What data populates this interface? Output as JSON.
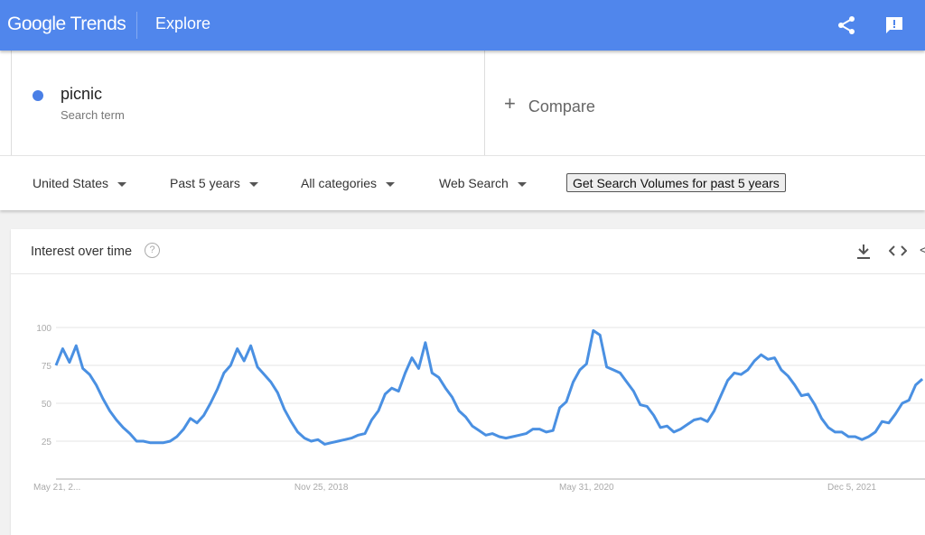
{
  "header": {
    "logo": "Google Trends",
    "section": "Explore",
    "icons": [
      "share-icon",
      "feedback-icon"
    ],
    "color": "#5086ec"
  },
  "search": {
    "term": "picnic",
    "term_type": "Search term",
    "term_color": "#4a7fe6",
    "compare_label": "Compare"
  },
  "filters": {
    "region": "United States",
    "time": "Past 5 years",
    "category": "All categories",
    "type": "Web Search",
    "volumes_button": "Get Search Volumes for past 5 years"
  },
  "card": {
    "title": "Interest over time",
    "icons": [
      "help-icon",
      "download-icon",
      "embed-icon",
      "share-icon"
    ]
  },
  "chart_data": {
    "type": "line",
    "title": "Interest over time",
    "series_color": "#4a90e2",
    "yticks": [
      "100",
      "75",
      "50",
      "25"
    ],
    "ylim": [
      0,
      100
    ],
    "xticks": [
      {
        "date": "2017-05-21",
        "label": "May 21, 2..."
      },
      {
        "date": "2018-11-25",
        "label": "Nov 25, 2018"
      },
      {
        "date": "2020-05-31",
        "label": "May 31, 2020"
      },
      {
        "date": "2021-12-05",
        "label": "Dec 5, 2021"
      }
    ],
    "grid": true,
    "x": [
      "2017-05-21",
      "2017-06-04",
      "2017-06-18",
      "2017-07-02",
      "2017-07-16",
      "2017-07-30",
      "2017-08-13",
      "2017-08-27",
      "2017-09-10",
      "2017-09-24",
      "2017-10-08",
      "2017-10-22",
      "2017-11-05",
      "2017-11-19",
      "2017-12-03",
      "2017-12-17",
      "2017-12-31",
      "2018-01-14",
      "2018-01-28",
      "2018-02-11",
      "2018-02-25",
      "2018-03-11",
      "2018-03-25",
      "2018-04-08",
      "2018-04-22",
      "2018-05-06",
      "2018-05-20",
      "2018-06-03",
      "2018-06-17",
      "2018-07-01",
      "2018-07-15",
      "2018-07-29",
      "2018-08-12",
      "2018-08-26",
      "2018-09-09",
      "2018-09-23",
      "2018-10-07",
      "2018-10-21",
      "2018-11-04",
      "2018-11-18",
      "2018-12-02",
      "2018-12-16",
      "2018-12-30",
      "2019-01-13",
      "2019-01-27",
      "2019-02-10",
      "2019-02-24",
      "2019-03-10",
      "2019-03-24",
      "2019-04-07",
      "2019-04-21",
      "2019-05-05",
      "2019-05-19",
      "2019-06-02",
      "2019-06-16",
      "2019-06-30",
      "2019-07-14",
      "2019-07-28",
      "2019-08-11",
      "2019-08-25",
      "2019-09-08",
      "2019-09-22",
      "2019-10-06",
      "2019-10-20",
      "2019-11-03",
      "2019-11-17",
      "2019-12-01",
      "2019-12-15",
      "2019-12-29",
      "2020-01-12",
      "2020-01-26",
      "2020-02-09",
      "2020-02-23",
      "2020-03-08",
      "2020-03-22",
      "2020-04-05",
      "2020-04-19",
      "2020-05-03",
      "2020-05-17",
      "2020-05-31",
      "2020-06-14",
      "2020-06-28",
      "2020-07-12",
      "2020-07-26",
      "2020-08-09",
      "2020-08-23",
      "2020-09-06",
      "2020-09-20",
      "2020-10-04",
      "2020-10-18",
      "2020-11-01",
      "2020-11-15",
      "2020-11-29",
      "2020-12-13",
      "2020-12-27",
      "2021-01-10",
      "2021-01-24",
      "2021-02-07",
      "2021-02-21",
      "2021-03-07",
      "2021-03-21",
      "2021-04-04",
      "2021-04-18",
      "2021-05-02",
      "2021-05-16",
      "2021-05-30",
      "2021-06-13",
      "2021-06-27",
      "2021-07-11",
      "2021-07-25",
      "2021-08-08",
      "2021-08-22",
      "2021-09-05",
      "2021-09-19",
      "2021-10-03",
      "2021-10-17",
      "2021-10-31",
      "2021-11-14",
      "2021-11-28",
      "2021-12-12",
      "2021-12-26",
      "2022-01-09",
      "2022-01-23",
      "2022-02-06",
      "2022-02-20",
      "2022-03-06",
      "2022-03-20",
      "2022-04-03",
      "2022-04-17",
      "2022-05-01"
    ],
    "values": [
      75,
      86,
      77,
      88,
      73,
      69,
      62,
      53,
      45,
      39,
      34,
      30,
      25,
      25,
      24,
      24,
      24,
      25,
      28,
      33,
      40,
      37,
      42,
      50,
      59,
      70,
      75,
      86,
      78,
      88,
      74,
      69,
      64,
      57,
      46,
      38,
      31,
      27,
      25,
      26,
      23,
      24,
      25,
      26,
      27,
      29,
      30,
      39,
      45,
      56,
      60,
      58,
      70,
      80,
      73,
      90,
      70,
      67,
      60,
      54,
      45,
      41,
      35,
      32,
      29,
      30,
      28,
      27,
      28,
      29,
      30,
      33,
      33,
      31,
      32,
      47,
      51,
      64,
      72,
      76,
      98,
      95,
      74,
      72,
      70,
      64,
      58,
      49,
      48,
      42,
      34,
      35,
      31,
      33,
      36,
      39,
      40,
      38,
      45,
      55,
      65,
      70,
      69,
      72,
      78,
      82,
      79,
      80,
      72,
      68,
      62,
      55,
      56,
      49,
      40,
      34,
      31,
      31,
      28,
      28,
      26,
      28,
      31,
      38,
      37,
      43,
      50,
      52,
      62,
      66
    ]
  }
}
